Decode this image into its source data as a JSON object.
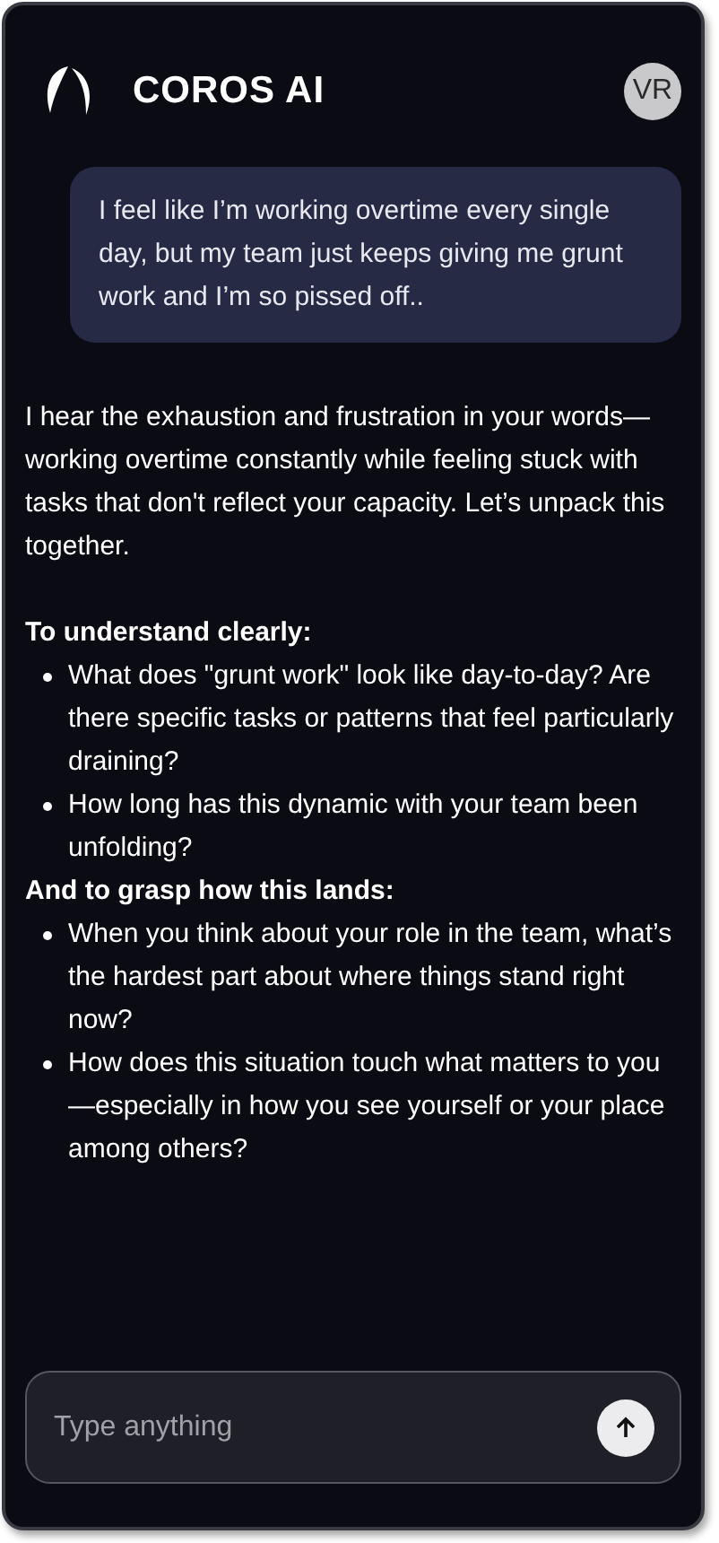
{
  "header": {
    "title": "COROS AI",
    "avatar": "VR"
  },
  "messages": [
    {
      "kind": "user",
      "text": "I feel like I’m working overtime every single day, but my team just keeps giving me grunt work and I’m so pissed off.."
    },
    {
      "kind": "assistant",
      "intro": "I hear the exhaustion and frustration in your words—working overtime constantly while feeling stuck with tasks that don't reflect your capacity. Let’s unpack this together.",
      "sections": [
        {
          "heading": "To understand clearly:",
          "bullets": [
            "What does \"grunt work\" look like day-to-day? Are there specific tasks or patterns that feel particularly draining?",
            "How long has this dynamic with your team been unfolding?"
          ]
        },
        {
          "heading": "And to grasp how this lands:",
          "bullets": [
            "When you think about your role in the team, what’s the hardest part about where things stand right now?",
            "How does this situation touch what matters to you—especially in how you see yourself or your place among others?"
          ]
        }
      ]
    }
  ],
  "composer": {
    "placeholder": "Type anything"
  }
}
